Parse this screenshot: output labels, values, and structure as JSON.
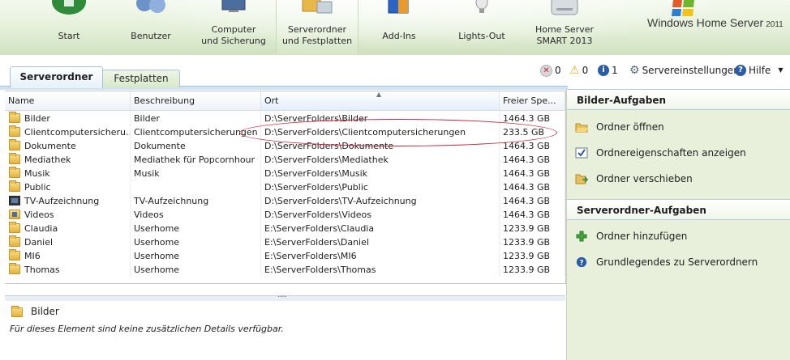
{
  "nav": {
    "items": [
      {
        "label1": "Start",
        "label2": ""
      },
      {
        "label1": "Benutzer",
        "label2": ""
      },
      {
        "label1": "Computer",
        "label2": "und Sicherung"
      },
      {
        "label1": "Serverordner",
        "label2": "und Festplatten"
      },
      {
        "label1": "Add-Ins",
        "label2": ""
      },
      {
        "label1": "Lights-Out",
        "label2": ""
      },
      {
        "label1": "Home Server",
        "label2": "SMART 2013"
      }
    ],
    "brand_main": "Windows Home Server",
    "brand_version": "2011"
  },
  "tabs": [
    "Serverordner",
    "Festplatten"
  ],
  "status": {
    "errors": "0",
    "warnings": "0",
    "infos": "1",
    "settings_label": "Servereinstellungen",
    "help_label": "Hilfe"
  },
  "grid": {
    "columns": [
      "Name",
      "Beschreibung",
      "Ort",
      "Freier Spe..."
    ],
    "rows": [
      {
        "name": "Bilder",
        "desc": "Bilder",
        "path": "D:\\ServerFolders\\Bilder",
        "free": "1464.3 GB",
        "icon": "folder"
      },
      {
        "name": "Clientcomputersicheru...",
        "desc": "Clientcomputersicherungen",
        "path": "D:\\ServerFolders\\Clientcomputersicherungen",
        "free": "233.5 GB",
        "icon": "folder"
      },
      {
        "name": "Dokumente",
        "desc": "Dokumente",
        "path": "D:\\ServerFolders\\Dokumente",
        "free": "1464.3 GB",
        "icon": "folder"
      },
      {
        "name": "Mediathek",
        "desc": "Mediathek für Popcornhour",
        "path": "D:\\ServerFolders\\Mediathek",
        "free": "1464.3 GB",
        "icon": "folder"
      },
      {
        "name": "Musik",
        "desc": "Musik",
        "path": "D:\\ServerFolders\\Musik",
        "free": "1464.3 GB",
        "icon": "folder"
      },
      {
        "name": "Public",
        "desc": "",
        "path": "D:\\ServerFolders\\Public",
        "free": "1464.3 GB",
        "icon": "folder"
      },
      {
        "name": "TV-Aufzeichnung",
        "desc": "TV-Aufzeichnung",
        "path": "D:\\ServerFolders\\TV-Aufzeichnung",
        "free": "1464.3 GB",
        "icon": "tv"
      },
      {
        "name": "Videos",
        "desc": "Videos",
        "path": "D:\\ServerFolders\\Videos",
        "free": "1464.3 GB",
        "icon": "video"
      },
      {
        "name": "Claudia",
        "desc": "Userhome",
        "path": "E:\\ServerFolders\\Claudia",
        "free": "1233.9 GB",
        "icon": "folder"
      },
      {
        "name": "Daniel",
        "desc": "Userhome",
        "path": "E:\\ServerFolders\\Daniel",
        "free": "1233.9 GB",
        "icon": "folder"
      },
      {
        "name": "MI6",
        "desc": "Userhome",
        "path": "E:\\ServerFolders\\MI6",
        "free": "1233.9 GB",
        "icon": "folder"
      },
      {
        "name": "Thomas",
        "desc": "Userhome",
        "path": "E:\\ServerFolders\\Thomas",
        "free": "1233.9 GB",
        "icon": "folder"
      }
    ]
  },
  "details": {
    "name": "Bilder",
    "message": "Für dieses Element sind keine zusätzlichen Details verfügbar."
  },
  "pane": {
    "section1_title": "Bilder-Aufgaben",
    "section1_tasks": [
      "Ordner öffnen",
      "Ordnereigenschaften anzeigen",
      "Ordner verschieben"
    ],
    "section2_title": "Serverordner-Aufgaben",
    "section2_tasks": [
      "Ordner hinzufügen",
      "Grundlegendes zu Serverordnern"
    ]
  },
  "colors": {
    "annotation": "#c2273a",
    "accent_blue": "#2a5ca8"
  }
}
